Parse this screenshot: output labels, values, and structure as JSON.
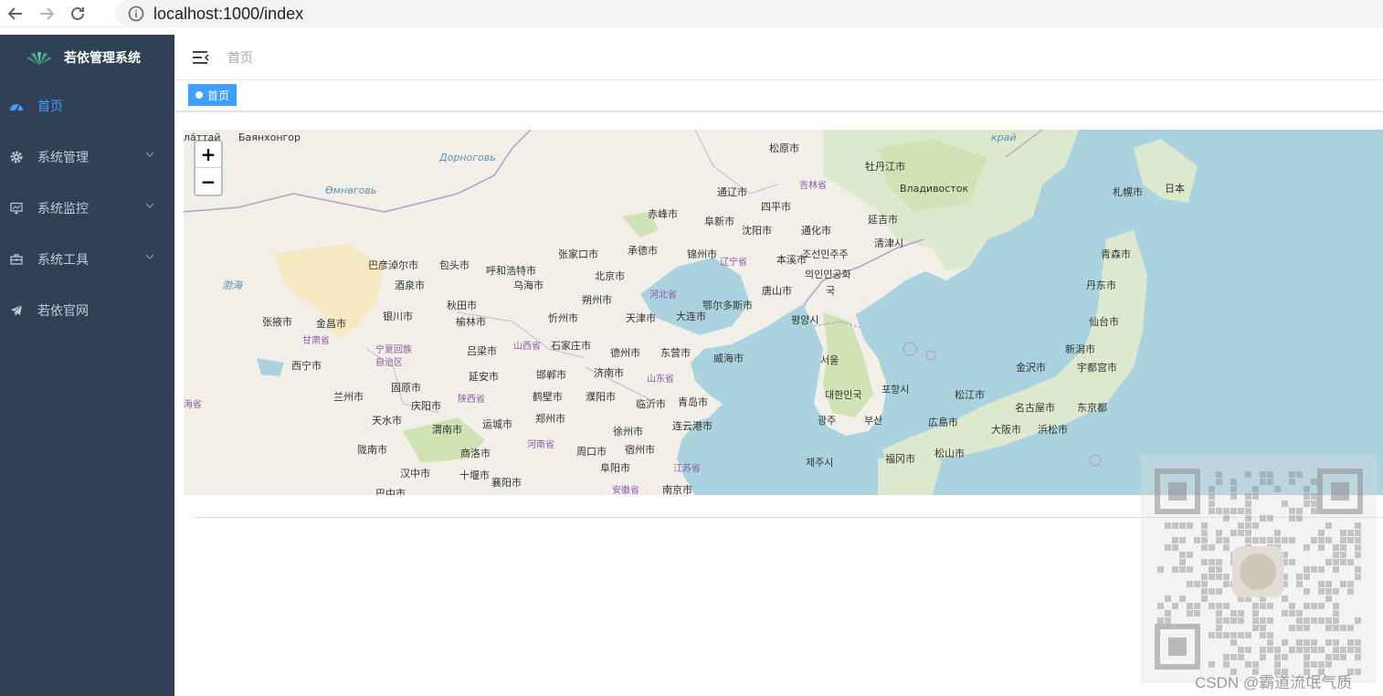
{
  "browser": {
    "url": "localhost:1000/index"
  },
  "sidebar": {
    "logo_title": "若依管理系统",
    "items": [
      {
        "label": "首页",
        "icon": "dashboard-icon",
        "active": true
      },
      {
        "label": "系统管理",
        "icon": "gear-icon",
        "expandable": true
      },
      {
        "label": "系统监控",
        "icon": "monitor-icon",
        "expandable": true
      },
      {
        "label": "系统工具",
        "icon": "toolbox-icon",
        "expandable": true
      },
      {
        "label": "若依官网",
        "icon": "send-icon"
      }
    ]
  },
  "navbar": {
    "breadcrumb": "首页"
  },
  "tags": [
    {
      "label": "首页",
      "active": true
    }
  ],
  "map": {
    "zoom_in": "+",
    "zoom_out": "−",
    "labels": [
      {
        "text": "Баянхонгор",
        "kind": "city-ru"
      },
      {
        "text": "Дорноговь",
        "kind": "sea"
      },
      {
        "text": "Өмнөговь",
        "kind": "sea"
      },
      {
        "text": "松原市"
      },
      {
        "text": "牡丹江市"
      },
      {
        "text": "吉林省",
        "kind": "prov"
      },
      {
        "text": "Владивосток"
      },
      {
        "text": "札幌市"
      },
      {
        "text": "日本"
      },
      {
        "text": "通辽市"
      },
      {
        "text": "四平市"
      },
      {
        "text": "赤峰市"
      },
      {
        "text": "阜新市"
      },
      {
        "text": "沈阳市"
      },
      {
        "text": "通化市"
      },
      {
        "text": "延吉市"
      },
      {
        "text": "清津시"
      },
      {
        "text": "张家口市"
      },
      {
        "text": "承德市"
      },
      {
        "text": "锦州市"
      },
      {
        "text": "辽宁省",
        "kind": "prov"
      },
      {
        "text": "本溪市"
      },
      {
        "text": "조선민주주"
      },
      {
        "text": "의인민공화"
      },
      {
        "text": "국"
      },
      {
        "text": "青森市"
      },
      {
        "text": "巴彦淖尔市"
      },
      {
        "text": "包头市"
      },
      {
        "text": "呼和浩特市"
      },
      {
        "text": "北京市"
      },
      {
        "text": "酒泉市"
      },
      {
        "text": "乌海市"
      },
      {
        "text": "朔州市"
      },
      {
        "text": "河北省",
        "kind": "prov"
      },
      {
        "text": "唐山市"
      },
      {
        "text": "丹东市"
      },
      {
        "text": "秋田市"
      },
      {
        "text": "鄂尔多斯市"
      },
      {
        "text": "大连市"
      },
      {
        "text": "渤海",
        "kind": "sea"
      },
      {
        "text": "张掖市"
      },
      {
        "text": "金昌市"
      },
      {
        "text": "银川市"
      },
      {
        "text": "榆林市"
      },
      {
        "text": "忻州市"
      },
      {
        "text": "天津市"
      },
      {
        "text": "평양시"
      },
      {
        "text": "仙台市"
      },
      {
        "text": "甘肃省",
        "kind": "prov"
      },
      {
        "text": "宁夏回族",
        "kind": "prov"
      },
      {
        "text": "自治区",
        "kind": "prov"
      },
      {
        "text": "吕梁市"
      },
      {
        "text": "山西省",
        "kind": "prov"
      },
      {
        "text": "石家庄市"
      },
      {
        "text": "德州市"
      },
      {
        "text": "东营市"
      },
      {
        "text": "威海市"
      },
      {
        "text": "서울"
      },
      {
        "text": "新潟市"
      },
      {
        "text": "西宁市"
      },
      {
        "text": "延安市"
      },
      {
        "text": "邯郸市"
      },
      {
        "text": "济南市"
      },
      {
        "text": "山东省",
        "kind": "prov"
      },
      {
        "text": "金沢市"
      },
      {
        "text": "宇都宫市"
      },
      {
        "text": "固原市"
      },
      {
        "text": "포항시"
      },
      {
        "text": "兰州市"
      },
      {
        "text": "庆阳市"
      },
      {
        "text": "陕西省",
        "kind": "prov"
      },
      {
        "text": "鹤壁市"
      },
      {
        "text": "濮阳市"
      },
      {
        "text": "临沂市"
      },
      {
        "text": "青岛市"
      },
      {
        "text": "대한민국"
      },
      {
        "text": "松江市"
      },
      {
        "text": "名古屋市"
      },
      {
        "text": "东京都"
      },
      {
        "text": "海省",
        "kind": "prov"
      },
      {
        "text": "天水市"
      },
      {
        "text": "渭南市"
      },
      {
        "text": "运城市"
      },
      {
        "text": "郑州市"
      },
      {
        "text": "徐州市"
      },
      {
        "text": "连云港市"
      },
      {
        "text": "광주"
      },
      {
        "text": "부산"
      },
      {
        "text": "広島市"
      },
      {
        "text": "大阪市"
      },
      {
        "text": "浜松市"
      },
      {
        "text": "陇南市"
      },
      {
        "text": "商洛市"
      },
      {
        "text": "河南省",
        "kind": "prov"
      },
      {
        "text": "周口市"
      },
      {
        "text": "宿州市"
      },
      {
        "text": "제주시"
      },
      {
        "text": "福冈市"
      },
      {
        "text": "松山市"
      },
      {
        "text": "汉中市"
      },
      {
        "text": "十堰市"
      },
      {
        "text": "阜阳市"
      },
      {
        "text": "江苏省",
        "kind": "prov"
      },
      {
        "text": "巴中市"
      },
      {
        "text": "襄阳市"
      },
      {
        "text": "安徽省",
        "kind": "prov"
      },
      {
        "text": "南京市"
      },
      {
        "text": "ла́ттай"
      },
      {
        "text": "край",
        "kind": "sea"
      }
    ]
  },
  "watermark": {
    "text": "CSDN @霸道流氓气质"
  }
}
